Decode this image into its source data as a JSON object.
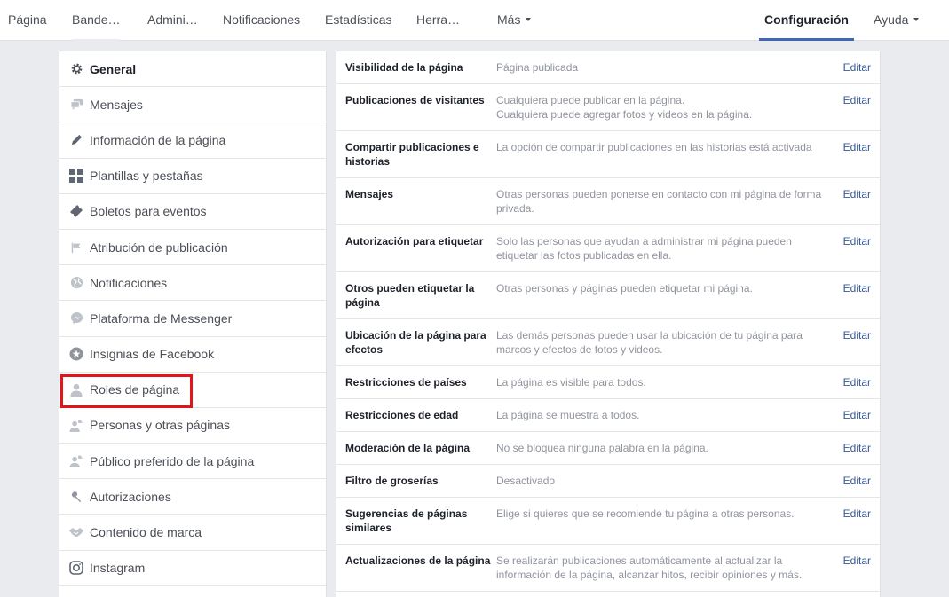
{
  "topnav": {
    "items": [
      "Página",
      "Bande…",
      "Admini…",
      "Notificaciones",
      "Estadísticas",
      "Herra…",
      "Más"
    ],
    "settings": "Configuración",
    "help": "Ayuda"
  },
  "sidebar": {
    "items": [
      {
        "label": "General",
        "icon": "gear-icon"
      },
      {
        "label": "Mensajes",
        "icon": "chat-bubble-icon"
      },
      {
        "label": "Información de la página",
        "icon": "pencil-icon"
      },
      {
        "label": "Plantillas y pestañas",
        "icon": "grid-icon"
      },
      {
        "label": "Boletos para eventos",
        "icon": "ticket-icon"
      },
      {
        "label": "Atribución de publicación",
        "icon": "flag-icon"
      },
      {
        "label": "Notificaciones",
        "icon": "globe-icon"
      },
      {
        "label": "Plataforma de Messenger",
        "icon": "messenger-icon"
      },
      {
        "label": "Insignias de Facebook",
        "icon": "badge-star-icon"
      },
      {
        "label": "Roles de página",
        "icon": "person-icon"
      },
      {
        "label": "Personas y otras páginas",
        "icon": "people-icon"
      },
      {
        "label": "Público preferido de la página",
        "icon": "people-icon"
      },
      {
        "label": "Autorizaciones",
        "icon": "wrench-icon"
      },
      {
        "label": "Contenido de marca",
        "icon": "handshake-icon"
      },
      {
        "label": "Instagram",
        "icon": "instagram-icon"
      }
    ]
  },
  "settings": {
    "edit_label": "Editar",
    "rows": [
      {
        "label": "Visibilidad de la página",
        "value": "Página publicada"
      },
      {
        "label": "Publicaciones de visitantes",
        "value": "Cualquiera puede publicar en la página.\nCualquiera puede agregar fotos y videos en la página."
      },
      {
        "label": "Compartir publicaciones e historias",
        "value": "La opción de compartir publicaciones en las historias está activada"
      },
      {
        "label": "Mensajes",
        "value": "Otras personas pueden ponerse en contacto con mi página de forma privada."
      },
      {
        "label": "Autorización para etiquetar",
        "value": "Solo las personas que ayudan a administrar mi página pueden etiquetar las fotos publicadas en ella."
      },
      {
        "label": "Otros pueden etiquetar la página",
        "value": "Otras personas y páginas pueden etiquetar mi página."
      },
      {
        "label": "Ubicación de la página para efectos",
        "value": "Las demás personas pueden usar la ubicación de tu página para marcos y efectos de fotos y videos."
      },
      {
        "label": "Restricciones de países",
        "value": "La página es visible para todos."
      },
      {
        "label": "Restricciones de edad",
        "value": "La página se muestra a todos."
      },
      {
        "label": "Moderación de la página",
        "value": "No se bloquea ninguna palabra en la página."
      },
      {
        "label": "Filtro de groserías",
        "value": "Desactivado"
      },
      {
        "label": "Sugerencias de páginas similares",
        "value": "Elige si quieres que se recomiende tu página a otras personas."
      },
      {
        "label": "Actualizaciones de la página",
        "value": "Se realizarán publicaciones automáticamente al actualizar la información de la página, alcanzar hitos, recibir opiniones y más."
      }
    ]
  },
  "colors": {
    "accent": "#4267b2",
    "link": "#365899",
    "highlight": "#e0161b"
  }
}
